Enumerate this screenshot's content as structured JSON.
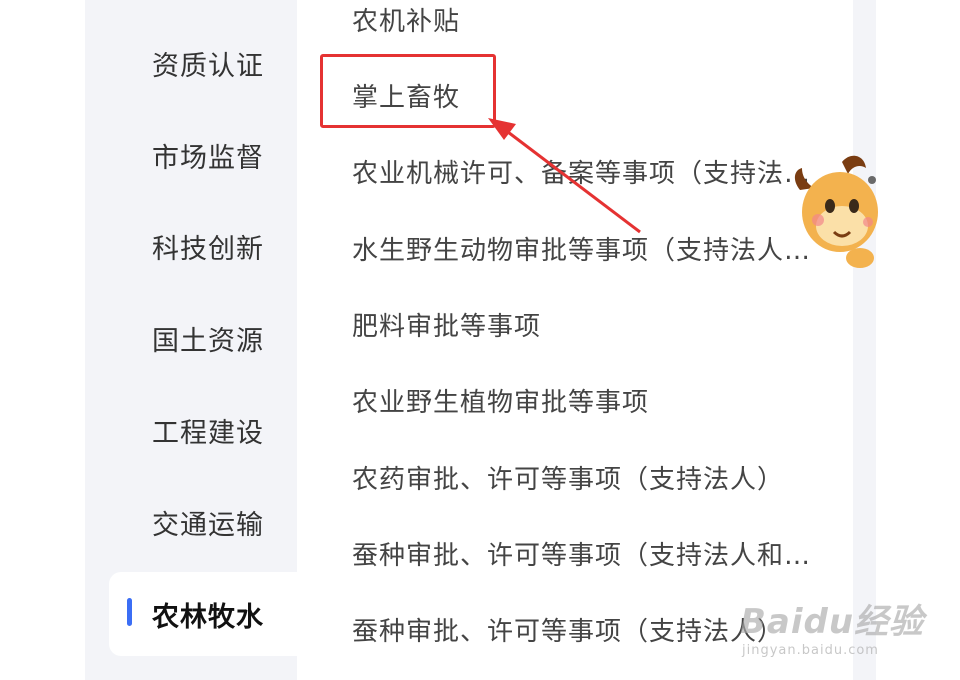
{
  "sidebar": {
    "items": [
      {
        "label": "资质认证"
      },
      {
        "label": "市场监督"
      },
      {
        "label": "科技创新"
      },
      {
        "label": "国土资源"
      },
      {
        "label": "工程建设"
      },
      {
        "label": "交通运输"
      },
      {
        "label": "农林牧水",
        "active": true
      }
    ]
  },
  "content": {
    "items": [
      {
        "label": "农机补贴"
      },
      {
        "label": "掌上畜牧",
        "highlighted": true
      },
      {
        "label": "农业机械许可、备案等事项（支持法…"
      },
      {
        "label": "水生野生动物审批等事项（支持法人…"
      },
      {
        "label": "肥料审批等事项"
      },
      {
        "label": "农业野生植物审批等事项"
      },
      {
        "label": "农药审批、许可等事项（支持法人）"
      },
      {
        "label": "蚕种审批、许可等事项（支持法人和…"
      },
      {
        "label": "蚕种审批、许可等事项（支持法人）"
      }
    ]
  },
  "colors": {
    "accent": "#3b6ef5",
    "annotation": "#e53232"
  },
  "watermark": {
    "logo": "Baidu经验",
    "sub": "jingyan.baidu.com"
  }
}
